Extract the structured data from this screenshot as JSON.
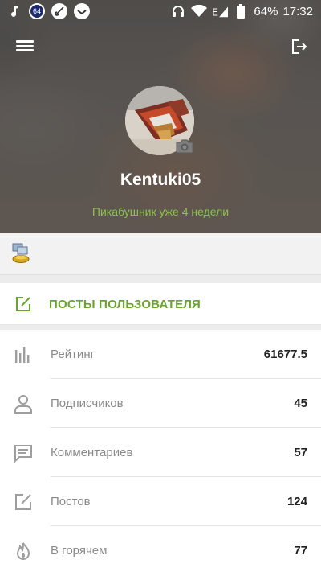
{
  "status_bar": {
    "badge_number": "64",
    "battery_percent": "64%",
    "time": "17:32",
    "icons_left": [
      "music-note-icon",
      "badge-64-icon",
      "guitar-app-icon",
      "app-check-icon"
    ],
    "icons_right": [
      "headphones-icon",
      "wifi-icon",
      "signal-e-icon",
      "battery-icon"
    ]
  },
  "header": {
    "menu_icon": "hamburger-menu-icon",
    "logout_icon": "logout-icon",
    "username": "Kentuki05",
    "since_text": "Пикабушник уже 4 недели"
  },
  "awards": {
    "icon": "award-badge-icon"
  },
  "posts_button": {
    "label": "ПОСТЫ ПОЛЬЗОВАТЕЛЯ",
    "icon": "edit-square-icon"
  },
  "stats": [
    {
      "name": "Рейтинг",
      "value": "61677.5",
      "icon": "rating-bars-icon"
    },
    {
      "name": "Подписчиков",
      "value": "45",
      "icon": "person-icon"
    },
    {
      "name": "Комментариев",
      "value": "57",
      "icon": "comment-icon"
    },
    {
      "name": "Постов",
      "value": "124",
      "icon": "edit-square-icon"
    },
    {
      "name": "В горячем",
      "value": "77",
      "icon": "fire-icon"
    }
  ],
  "colors": {
    "accent_green": "#6aa52a",
    "since_green": "#8bc34a",
    "icon_gray": "#9e9e9e"
  }
}
